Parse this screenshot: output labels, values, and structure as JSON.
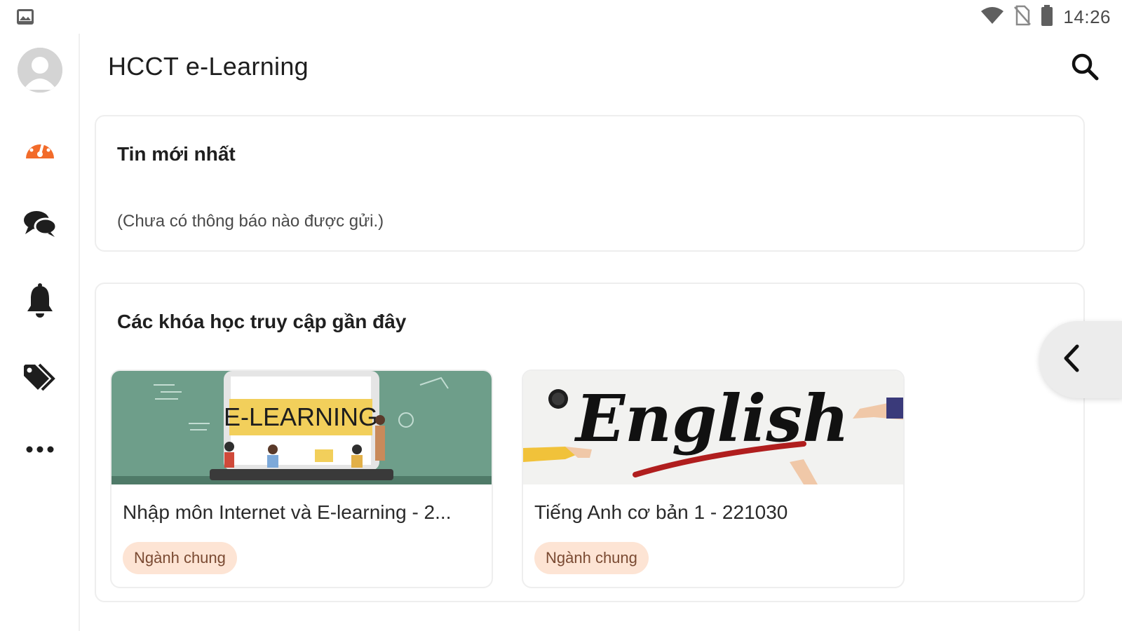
{
  "status_bar": {
    "time": "14:26",
    "icons": [
      "image-icon",
      "wifi-icon",
      "no-sim-icon",
      "battery-icon"
    ]
  },
  "rail": {
    "items": [
      {
        "name": "avatar",
        "icon": "user-avatar-icon"
      },
      {
        "name": "dashboard",
        "icon": "dashboard-icon",
        "active": true,
        "color": "#f26b2a"
      },
      {
        "name": "messages",
        "icon": "chat-icon"
      },
      {
        "name": "notifications",
        "icon": "bell-icon"
      },
      {
        "name": "tags",
        "icon": "tag-icon"
      },
      {
        "name": "more",
        "icon": "more-horizontal-icon"
      }
    ]
  },
  "header": {
    "title": "HCCT e-Learning",
    "search_icon": "search-icon"
  },
  "news": {
    "title": "Tin mới nhất",
    "empty_text": "(Chưa có thông báo nào được gửi.)"
  },
  "recent": {
    "title": "Các khóa học truy cập gần đây",
    "courses": [
      {
        "name": "Nhập môn Internet và E-learning - 2...",
        "tag": "Ngành chung",
        "image_text": "E-LEARNING"
      },
      {
        "name": "Tiếng Anh cơ bản 1 - 221030",
        "tag": "Ngành chung",
        "image_text": "English"
      }
    ]
  },
  "drawer_toggle_icon": "chevron-left-icon",
  "colors": {
    "accent": "#f26b2a",
    "tag_bg": "#fde4d4",
    "tag_text": "#7a4a32",
    "elearning_bg": "#6e9e8a",
    "elearning_banner": "#f2cf5b"
  }
}
